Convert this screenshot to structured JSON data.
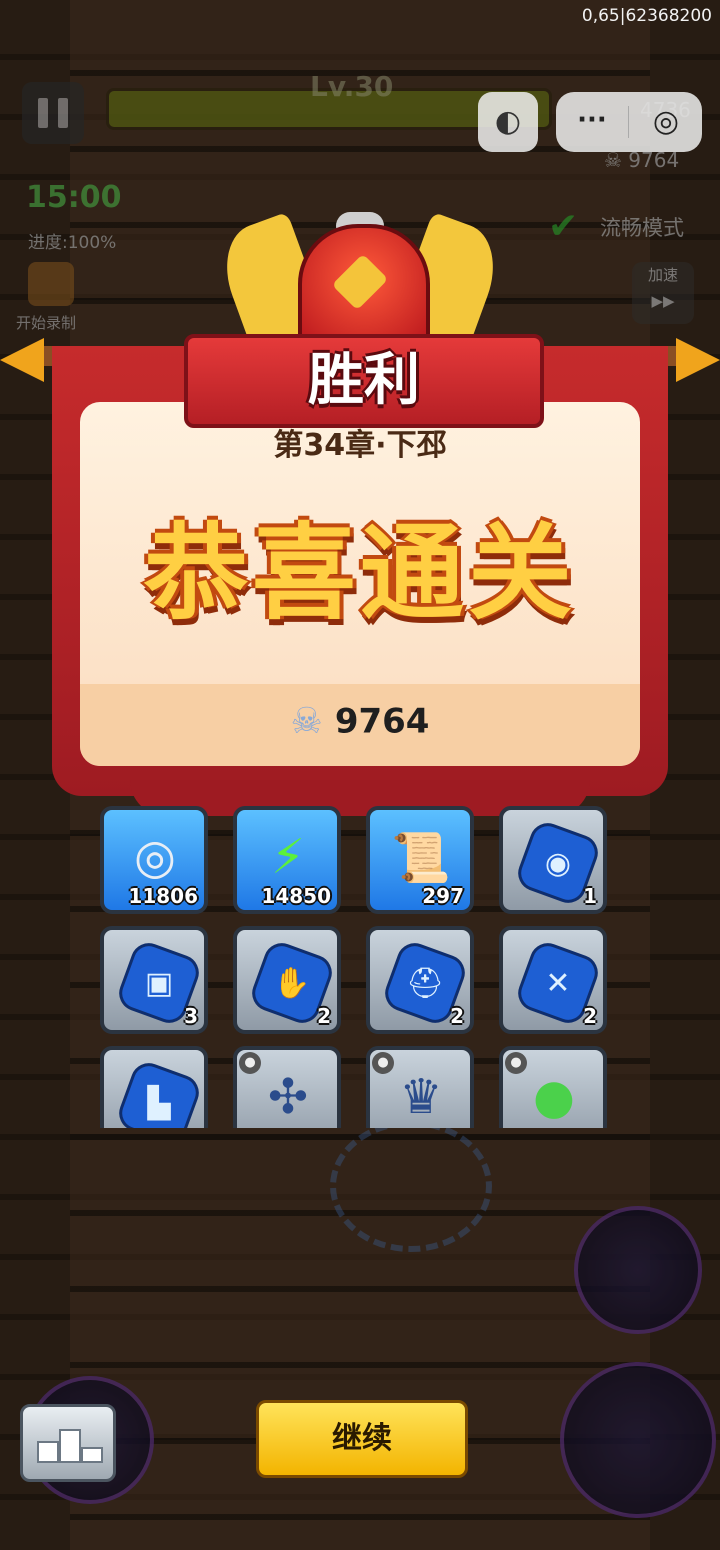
{
  "status_bar": {
    "id_text": "0,65|62368200"
  },
  "hud": {
    "level": "Lv.30",
    "timer": "15:00",
    "progress": "进度:100%",
    "record_label": "开始录制",
    "currency_coins": "4736",
    "skull_count": "9764",
    "smooth_mode": "流畅模式",
    "speed_label": "加速",
    "speed_arrow": "▶▶"
  },
  "miniprogram": {
    "more_glyph": "···",
    "close_glyph": "◎",
    "menu_glyph": "◐"
  },
  "result": {
    "title": "胜利",
    "chapter": "第34章·下邳",
    "congrats": "恭喜通关",
    "reward_value": "9764"
  },
  "items": [
    {
      "type": "coin",
      "qty": "11806",
      "glyph": "◎",
      "style": "blue"
    },
    {
      "type": "energy",
      "qty": "14850",
      "glyph": "⚡",
      "style": "blue"
    },
    {
      "type": "scroll",
      "qty": "297",
      "glyph": "📜",
      "style": "blue"
    },
    {
      "type": "stone-medal",
      "qty": "1",
      "glyph": "◉",
      "style": "gray"
    },
    {
      "type": "stone-armor",
      "qty": "3",
      "glyph": "▣",
      "style": "gray"
    },
    {
      "type": "stone-glove",
      "qty": "2",
      "glyph": "✋",
      "style": "gray"
    },
    {
      "type": "stone-helmet",
      "qty": "2",
      "glyph": "⛑",
      "style": "gray"
    },
    {
      "type": "stone-sword",
      "qty": "2",
      "glyph": "✕",
      "style": "gray"
    },
    {
      "type": "stone-boot",
      "qty": "",
      "glyph": "▙",
      "style": "gray"
    },
    {
      "type": "weapon-shuriken",
      "qty": "",
      "glyph": "✣",
      "style": "gray"
    },
    {
      "type": "helmet-crown",
      "qty": "",
      "glyph": "♛",
      "style": "gray"
    },
    {
      "type": "amulet",
      "qty": "",
      "glyph": "●",
      "style": "gray"
    }
  ],
  "buttons": {
    "continue": "继续"
  },
  "colors": {
    "accent": "#f3b400",
    "banner": "#c62b2c",
    "card": "#fff2e0"
  }
}
